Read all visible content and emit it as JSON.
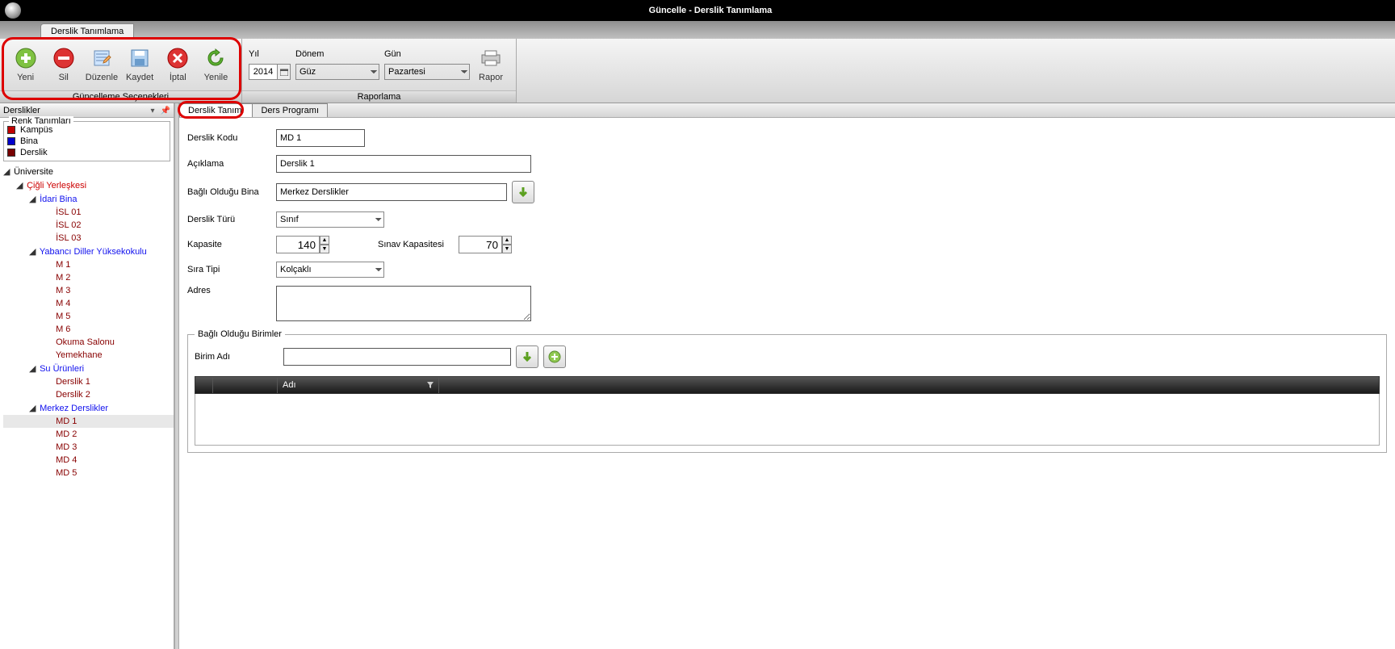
{
  "window": {
    "title": "Güncelle - Derslik Tanımlama"
  },
  "doctab": "Derslik Tanımlama",
  "ribbon": {
    "group_update_title": "Güncelleme Seçenekleri",
    "group_report_title": "Raporlama",
    "yeni": "Yeni",
    "sil": "Sil",
    "duzenle": "Düzenle",
    "kaydet": "Kaydet",
    "iptal": "İptal",
    "yenile": "Yenile",
    "rapor": "Rapor",
    "yil_label": "Yıl",
    "yil_value": "2014",
    "donem_label": "Dönem",
    "donem_value": "Güz",
    "gun_label": "Gün",
    "gun_value": "Pazartesi"
  },
  "sidebar": {
    "title": "Derslikler",
    "legend_title": "Renk Tanımları",
    "legend": [
      {
        "label": "Kampüs",
        "color": "#c00000"
      },
      {
        "label": "Bina",
        "color": "#0000cc"
      },
      {
        "label": "Derslik",
        "color": "#770000"
      }
    ],
    "tree": {
      "root": "Üniversite",
      "kampus": "Çiğli Yerleşkesi",
      "binalar": [
        {
          "name": "İdari Bina",
          "derslikler": [
            "İSL 01",
            "İSL 02",
            "İSL 03"
          ]
        },
        {
          "name": "Yabancı Diller Yüksekokulu",
          "derslikler": [
            "M 1",
            "M 2",
            "M 3",
            "M 4",
            "M 5",
            "M 6",
            "Okuma Salonu",
            "Yemekhane"
          ]
        },
        {
          "name": "Su Ürünleri",
          "derslikler": [
            "Derslik 1",
            "Derslik 2"
          ]
        },
        {
          "name": "Merkez Derslikler",
          "derslikler": [
            "MD 1",
            "MD 2",
            "MD 3",
            "MD 4",
            "MD 5"
          ]
        }
      ],
      "selected": "MD 1"
    }
  },
  "subtabs": {
    "tab1": "Derslik Tanımı",
    "tab2": "Ders Programı"
  },
  "form": {
    "derslik_kodu_label": "Derslik Kodu",
    "derslik_kodu_value": "MD 1",
    "aciklama_label": "Açıklama",
    "aciklama_value": "Derslik 1",
    "bagli_bina_label": "Bağlı Olduğu Bina",
    "bagli_bina_value": "Merkez Derslikler",
    "derslik_turu_label": "Derslik Türü",
    "derslik_turu_value": "Sınıf",
    "kapasite_label": "Kapasite",
    "kapasite_value": "140",
    "sinav_kapasitesi_label": "Sınav Kapasitesi",
    "sinav_kapasitesi_value": "70",
    "sira_tipi_label": "Sıra Tipi",
    "sira_tipi_value": "Kolçaklı",
    "adres_label": "Adres",
    "adres_value": ""
  },
  "birimler": {
    "legend": "Bağlı Olduğu Birimler",
    "birim_adi_label": "Birim Adı",
    "birim_adi_value": "",
    "grid_col_adi": "Adı"
  }
}
